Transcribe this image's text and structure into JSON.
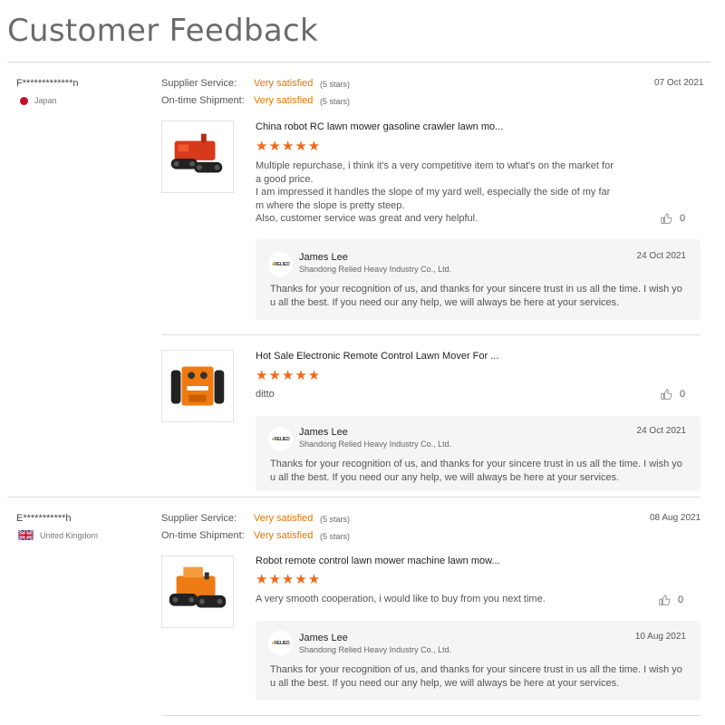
{
  "page": {
    "title": "Customer Feedback"
  },
  "labels": {
    "supplier_service": "Supplier Service:",
    "ontime_shipment": "On-time Shipment:"
  },
  "colors": {
    "accent": "#e07800",
    "stars": "#f0691b",
    "reply_bg": "#f5f5f5"
  },
  "reviews": [
    {
      "buyer": "F*************n",
      "country": "Japan",
      "country_flag": "flag-japan-icon",
      "supplier_rating": "Very satisfied",
      "supplier_stars": "(5 stars)",
      "shipment_rating": "Very satisfied",
      "shipment_stars": "(5 stars)",
      "date": "07 Oct 2021",
      "products": [
        {
          "title": "China robot RC lawn mower gasoline crawler lawn mo...",
          "stars": "★★★★★",
          "text": [
            "Multiple repurchase, i think it's a very competitive item to what's on the market for",
            "a good price.",
            "I am impressed it handles the slope of my yard well, especially the side of my far",
            "m where the slope is pretty steep.",
            "Also, customer service was great and very helpful."
          ],
          "likes": "0",
          "reply": {
            "logo": "RELIED",
            "name": "James Lee",
            "company": "Shandong Relied Heavy Industry Co., Ltd.",
            "date": "24 Oct 2021",
            "text": [
              "Thanks for your recognition of us, and thanks for your sincere trust in us all the time. I wish yo",
              "u all the best. If you need our any help, we will always be here at your services."
            ]
          }
        },
        {
          "title": "Hot Sale Electronic Remote Control Lawn Mover For ...",
          "stars": "★★★★★",
          "text": [
            "ditto"
          ],
          "likes": "0",
          "reply": {
            "logo": "RELIED",
            "name": "James Lee",
            "company": "Shandong Relied Heavy Industry Co., Ltd.",
            "date": "24 Oct 2021",
            "text": [
              "Thanks for your recognition of us, and thanks for your sincere trust in us all the time. I wish yo",
              "u all the best. If you need our any help, we will always be here at your services."
            ]
          }
        }
      ]
    },
    {
      "buyer": "E***********h",
      "country": "United Kingdom",
      "country_flag": "flag-uk-icon",
      "supplier_rating": "Very satisfied",
      "supplier_stars": "(5 stars)",
      "shipment_rating": "Very satisfied",
      "shipment_stars": "(5 stars)",
      "date": "08 Aug 2021",
      "products": [
        {
          "title": "Robot remote control lawn mower machine lawn mow...",
          "stars": "★★★★★",
          "text": [
            "A very smooth cooperation, i would like to buy from you next time."
          ],
          "likes": "0",
          "reply": {
            "logo": "RELIED",
            "name": "James Lee",
            "company": "Shandong Relied Heavy Industry Co., Ltd.",
            "date": "10 Aug 2021",
            "text": [
              "Thanks for your recognition of us, and thanks for your sincere trust in us all the time. I wish yo",
              "u all the best. If you need our any help, we will always be here at your services."
            ]
          }
        }
      ]
    }
  ]
}
